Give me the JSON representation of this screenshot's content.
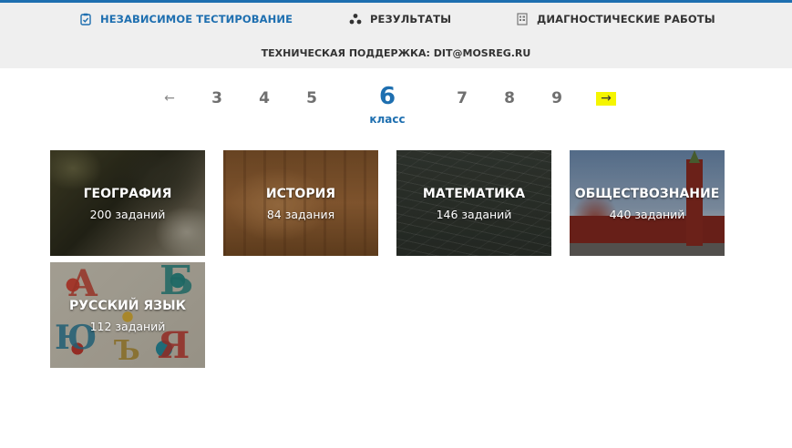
{
  "nav": {
    "tests": {
      "label": "НЕЗАВИСИМОЕ ТЕСТИРОВАНИЕ",
      "icon": "clipboard-check-icon"
    },
    "results": {
      "label": "РЕЗУЛЬТАТЫ",
      "icon": "triangle-dots-icon"
    },
    "diagnostics": {
      "label": "ДИАГНОСТИЧЕСКИЕ РАБОТЫ",
      "icon": "document-grid-icon"
    }
  },
  "support": "ТЕХНИЧЕСКАЯ ПОДДЕРЖКА: DIT@MOSREG.RU",
  "pager": {
    "prev": "←",
    "next": "→",
    "before": [
      "3",
      "4",
      "5"
    ],
    "current": "6",
    "current_label": "класс",
    "after": [
      "7",
      "8",
      "9"
    ]
  },
  "subjects": [
    {
      "title": "ГЕОГРАФИЯ",
      "count": "200 заданий"
    },
    {
      "title": "ИСТОРИЯ",
      "count": "84 задания"
    },
    {
      "title": "МАТЕМАТИКА",
      "count": "146 заданий"
    },
    {
      "title": "ОБЩЕСТВОЗНАНИЕ",
      "count": "440 заданий"
    },
    {
      "title": "РУССКИЙ ЯЗЫК",
      "count": "112 заданий"
    }
  ],
  "colors": {
    "accent": "#1e6fb0",
    "highlight": "#f5f500",
    "topbar": "#efefef"
  }
}
